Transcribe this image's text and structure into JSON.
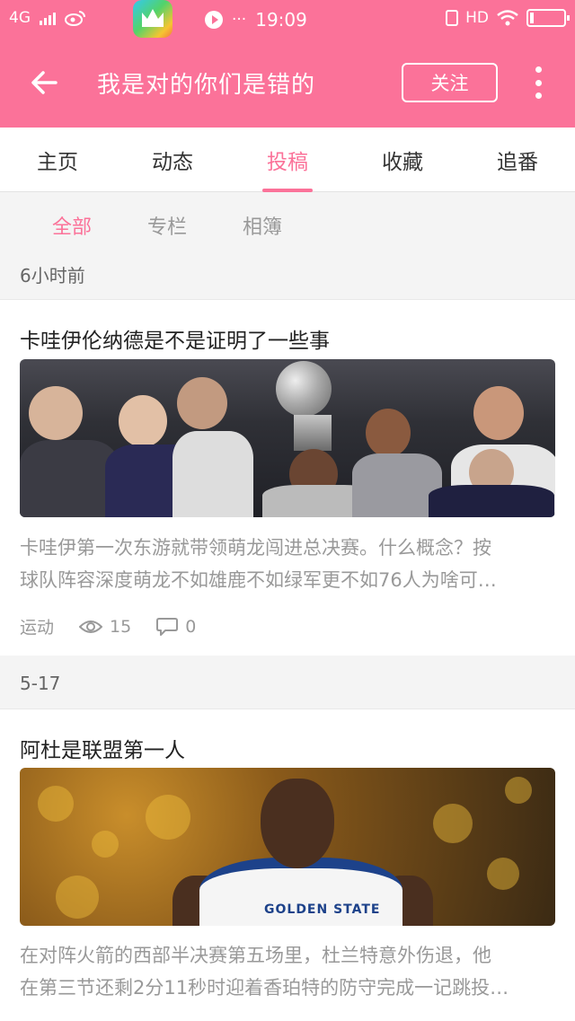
{
  "status_bar": {
    "network": "4G",
    "time": "19:09",
    "dots": "···",
    "hd": "HD"
  },
  "header": {
    "title": "我是对的你们是错的",
    "follow_label": "关注"
  },
  "tabs": [
    {
      "label": "主页",
      "active": false
    },
    {
      "label": "动态",
      "active": false
    },
    {
      "label": "投稿",
      "active": true
    },
    {
      "label": "收藏",
      "active": false
    },
    {
      "label": "追番",
      "active": false
    }
  ],
  "subtabs": [
    {
      "label": "全部",
      "active": true
    },
    {
      "label": "专栏",
      "active": false
    },
    {
      "label": "相簿",
      "active": false
    }
  ],
  "feed": [
    {
      "date": "6小时前",
      "title": "卡哇伊伦纳德是不是证明了一些事",
      "desc_line1": "卡哇伊第一次东游就带领萌龙闯进总决赛。什么概念？按",
      "desc_line2": "球队阵容深度萌龙不如雄鹿不如绿军更不如76人为啥可…",
      "category": "运动",
      "views": "15",
      "comments": "0"
    },
    {
      "date": "5-17",
      "title": "阿杜是联盟第一人",
      "desc_line1": "在对阵火箭的西部半决赛第五场里，杜兰特意外伤退，他",
      "desc_line2": "在第三节还剩2分11秒时迎着香珀特的防守完成一记跳投…",
      "jersey_text": "GOLDEN STATE"
    }
  ],
  "colors": {
    "accent": "#fb7299",
    "muted_text": "#999999",
    "background": "#f4f4f4"
  }
}
